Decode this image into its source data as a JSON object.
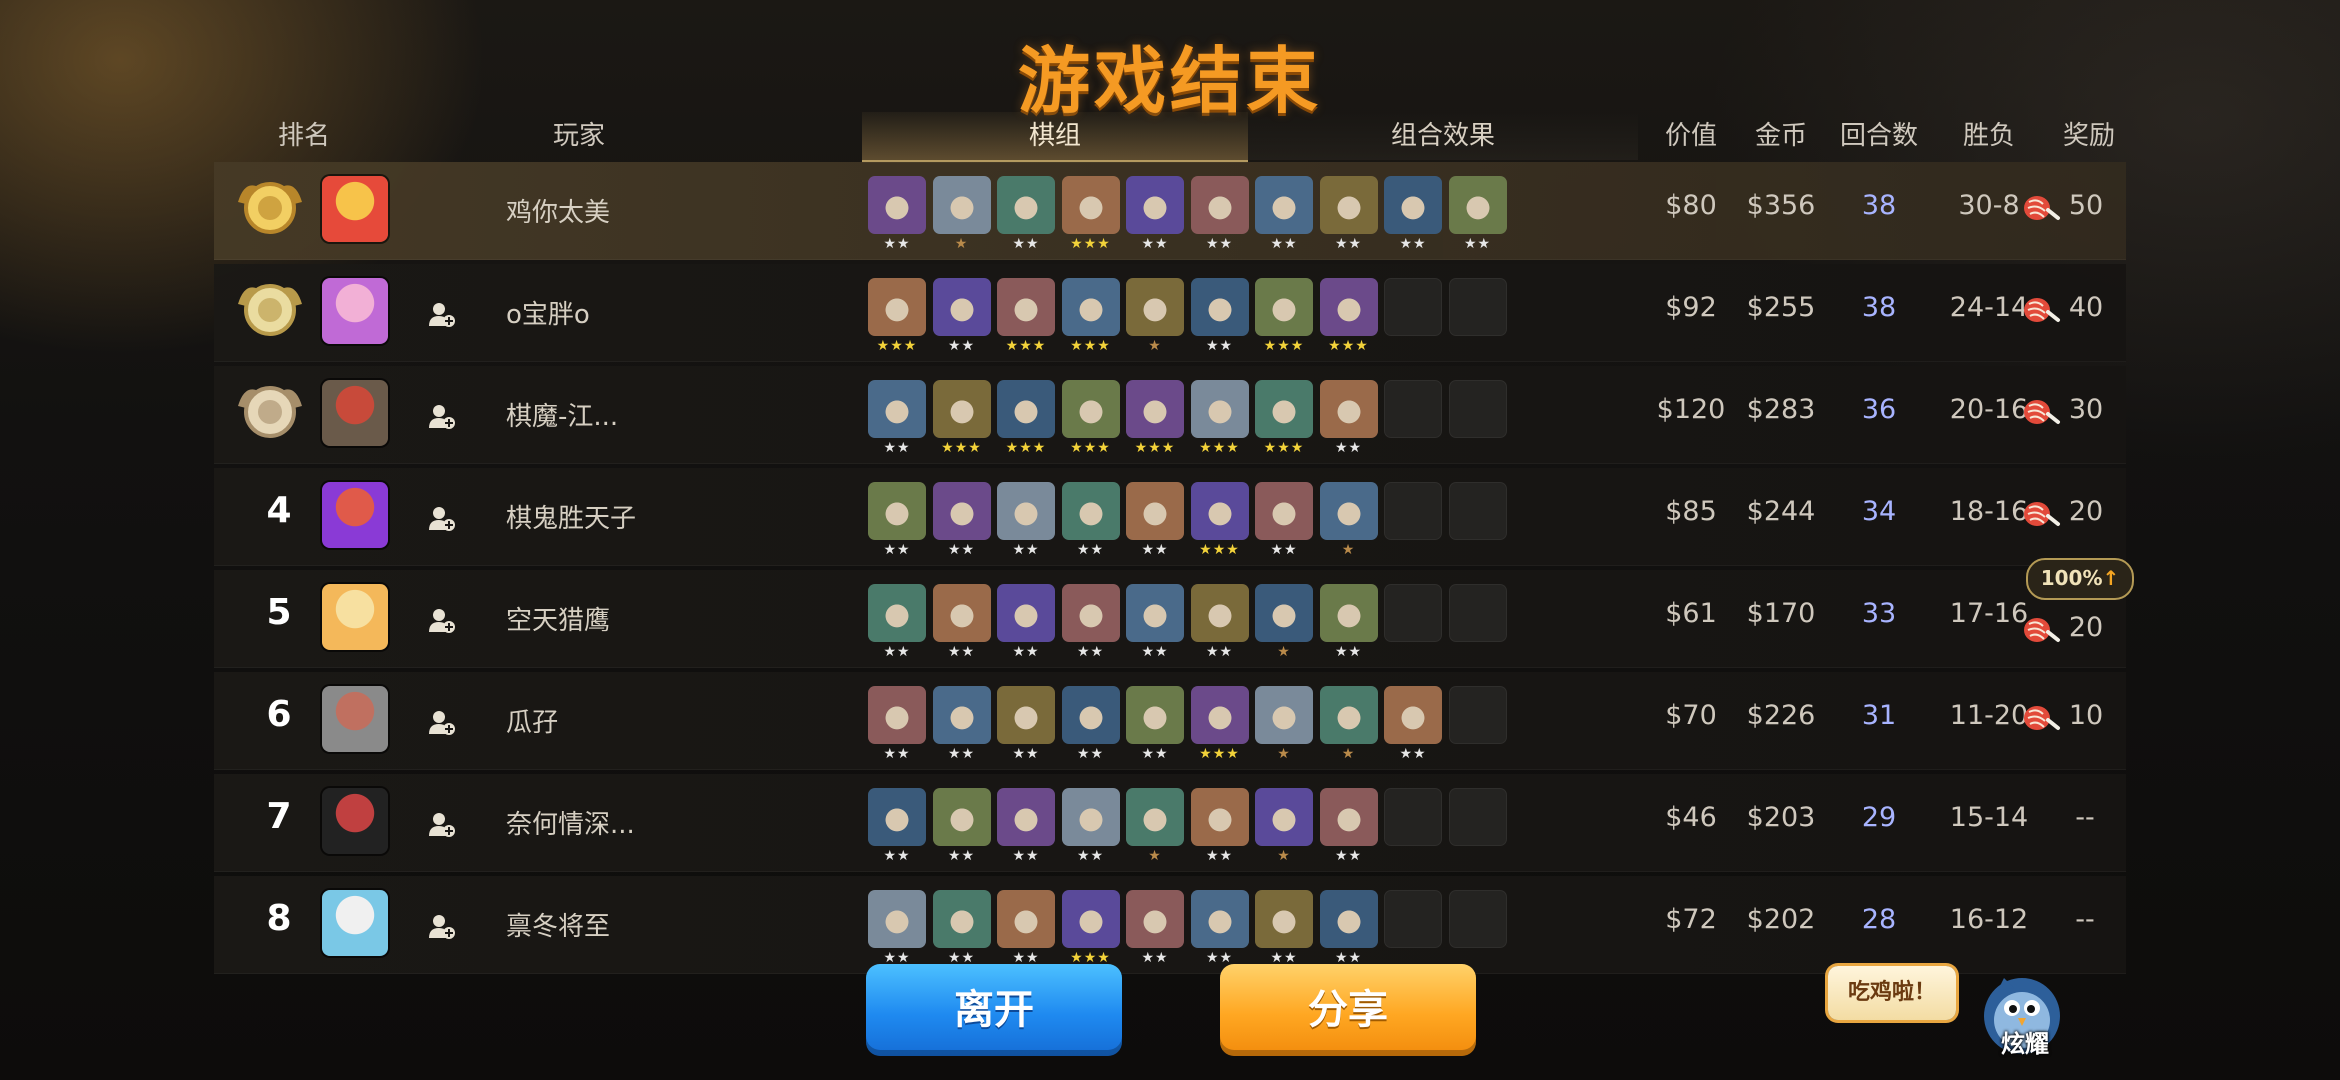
{
  "title": "游戏结束",
  "header": {
    "rank": "排名",
    "player": "玩家",
    "tab_board": "棋组",
    "tab_combo": "组合效果",
    "value": "价值",
    "gold": "金币",
    "rounds": "回合数",
    "winloss": "胜负",
    "reward": "奖励"
  },
  "colors": {
    "title": "#f59a23",
    "rounds": "#a8b4ff",
    "leave": "#1f8af0",
    "share": "#ffa722"
  },
  "players": [
    {
      "rank": "",
      "name": "鸡你太美",
      "value": "$80",
      "gold": "$356",
      "rounds": "38",
      "winloss": "30-8",
      "reward": "50",
      "stars": [
        2,
        1,
        2,
        3,
        2,
        2,
        2,
        2,
        2,
        2
      ]
    },
    {
      "rank": "",
      "name": "o宝胖o",
      "value": "$92",
      "gold": "$255",
      "rounds": "38",
      "winloss": "24-14",
      "reward": "40",
      "stars": [
        3,
        2,
        3,
        3,
        1,
        2,
        3,
        3,
        0,
        0
      ]
    },
    {
      "rank": "",
      "name": "棋魔-江...",
      "value": "$120",
      "gold": "$283",
      "rounds": "36",
      "winloss": "20-16",
      "reward": "30",
      "stars": [
        2,
        3,
        3,
        3,
        3,
        3,
        3,
        2,
        0,
        0
      ]
    },
    {
      "rank": "4",
      "name": "棋鬼胜天子",
      "value": "$85",
      "gold": "$244",
      "rounds": "34",
      "winloss": "18-16",
      "reward": "20",
      "stars": [
        2,
        2,
        2,
        2,
        2,
        3,
        2,
        1,
        0,
        0
      ]
    },
    {
      "rank": "5",
      "name": "空天猎鹰",
      "value": "$61",
      "gold": "$170",
      "rounds": "33",
      "winloss": "17-16",
      "reward": "20",
      "bonus": "100%",
      "stars": [
        2,
        2,
        2,
        2,
        2,
        2,
        1,
        2,
        0,
        0
      ]
    },
    {
      "rank": "6",
      "name": "瓜孖",
      "value": "$70",
      "gold": "$226",
      "rounds": "31",
      "winloss": "11-20",
      "reward": "10",
      "stars": [
        2,
        2,
        2,
        2,
        2,
        3,
        1,
        1,
        2,
        0
      ]
    },
    {
      "rank": "7",
      "name": "奈何情深...",
      "value": "$46",
      "gold": "$203",
      "rounds": "29",
      "winloss": "15-14",
      "reward": "--",
      "stars": [
        2,
        2,
        2,
        2,
        1,
        2,
        1,
        2,
        0,
        0
      ]
    },
    {
      "rank": "8",
      "name": "禀冬将至",
      "value": "$72",
      "gold": "$202",
      "rounds": "28",
      "winloss": "16-12",
      "reward": "--",
      "stars": [
        2,
        2,
        2,
        3,
        2,
        2,
        2,
        2,
        0,
        0
      ]
    }
  ],
  "buttons": {
    "leave": "离开",
    "share": "分享"
  },
  "bubble": "吃鸡啦！",
  "bird_label": "炫耀"
}
